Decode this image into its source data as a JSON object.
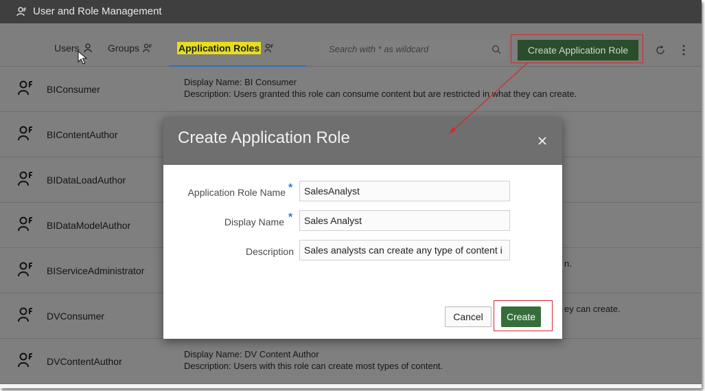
{
  "app": {
    "title": "User and Role Management",
    "title_icon": "users-icon"
  },
  "toolbar": {
    "tabs": [
      {
        "label": "Users",
        "icon": "user-icon"
      },
      {
        "label": "Groups",
        "icon": "group-icon"
      },
      {
        "label": "Application Roles",
        "icon": "app-role-icon",
        "selected": true
      }
    ],
    "search_placeholder": "Search with * as wildcard",
    "create_button": "Create Application Role",
    "refresh_icon": "refresh-icon",
    "more_icon": "more-vertical-icon"
  },
  "roles": [
    {
      "name": "BIConsumer",
      "display": "Display Name: BI Consumer",
      "description": "Description: Users granted this role can consume content but are restricted in what they can create."
    },
    {
      "name": "BIContentAuthor",
      "display": "",
      "description": ""
    },
    {
      "name": "BIDataLoadAuthor",
      "display": "",
      "description": ""
    },
    {
      "name": "BIDataModelAuthor",
      "display": "",
      "description": ""
    },
    {
      "name": "BIServiceAdministrator",
      "display": "",
      "description": "n."
    },
    {
      "name": "DVConsumer",
      "display": "",
      "description": "ey can create."
    },
    {
      "name": "DVContentAuthor",
      "display": "Display Name: DV Content Author",
      "description": "Description: Users with this role can create most types of content."
    }
  ],
  "dialog": {
    "title": "Create Application Role",
    "fields": {
      "role_name_label": "Application Role Name",
      "role_name_value": "SalesAnalyst",
      "display_name_label": "Display Name",
      "display_name_value": "Sales Analyst",
      "description_label": "Description",
      "description_value": "Sales analysts can create any type of content i",
      "required_marker": "*"
    },
    "cancel_label": "Cancel",
    "create_label": "Create"
  },
  "colors": {
    "highlight": "#e7df1e",
    "annotation_red": "#d9262a",
    "create_green": "#356e3a",
    "required_blue": "#2e7bd6"
  }
}
